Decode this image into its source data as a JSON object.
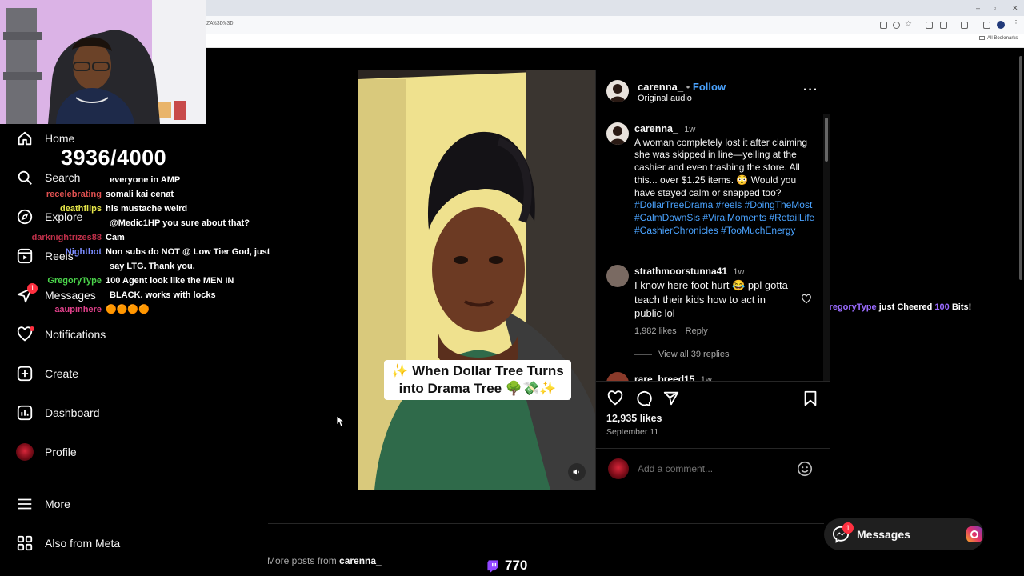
{
  "browser": {
    "url_fragment": "ZA%3D%3D",
    "bookmarks_label": "All Bookmarks",
    "window_controls": [
      "–",
      "▫",
      "✕"
    ]
  },
  "sidebar": {
    "items": [
      {
        "label": "Home",
        "icon": "home-icon"
      },
      {
        "label": "Search",
        "icon": "search-icon"
      },
      {
        "label": "Explore",
        "icon": "compass-icon"
      },
      {
        "label": "Reels",
        "icon": "reels-icon"
      },
      {
        "label": "Messages",
        "icon": "send-icon",
        "badge": "1"
      },
      {
        "label": "Notifications",
        "icon": "heart-icon"
      },
      {
        "label": "Create",
        "icon": "plus-square-icon"
      },
      {
        "label": "Dashboard",
        "icon": "chart-icon"
      },
      {
        "label": "Profile",
        "icon": "avatar-icon"
      },
      {
        "label": "More",
        "icon": "menu-icon"
      },
      {
        "label": "Also from Meta",
        "icon": "meta-icon"
      }
    ]
  },
  "overlay": {
    "counter": "3936/4000",
    "chat": [
      {
        "user": "",
        "user_color": "#ffffff",
        "message": "everyone in AMP"
      },
      {
        "user": "recelebrating",
        "user_color": "#e05050",
        "message": "somali kai cenat"
      },
      {
        "user": "deathflips",
        "user_color": "#e8e84a",
        "message": "his mustache weird"
      },
      {
        "user": "",
        "user_color": "#ffffff",
        "message": "@Medic1HP you sure about that?"
      },
      {
        "user": "darknightrizes88",
        "user_color": "#c0304a",
        "message": "Cam"
      },
      {
        "user": "Nightbot",
        "user_color": "#7b8cff",
        "message": "Non subs do NOT @ Low Tier God, just"
      },
      {
        "user": "",
        "user_color": "#ffffff",
        "message": "say LTG. Thank you."
      },
      {
        "user": "GregoryType",
        "user_color": "#4bd54b",
        "message": "100 Agent look like the MEN IN"
      },
      {
        "user": "",
        "user_color": "#ffffff",
        "message": "BLACK. works with locks"
      },
      {
        "user": "aaupinhere",
        "user_color": "#e0408a",
        "message": "🟠🟠🟠🟠"
      }
    ],
    "cheer": {
      "user": "GregoryType",
      "text": " just Cheered ",
      "amount": "100",
      "suffix": " Bits!"
    },
    "viewer_count": "770"
  },
  "post": {
    "video_caption_line1": "✨ When Dollar Tree Turns",
    "video_caption_line2": "into Drama Tree 🌳💸✨",
    "author": "carenna_",
    "follow_sep": "•",
    "follow_label": "Follow",
    "audio_label": "Original audio",
    "caption": {
      "user": "carenna_",
      "time": "1w",
      "text": "A woman completely lost it after claiming she was skipped in line—yelling at the cashier and even trashing the store. All this... over $1.25 items. 😳 Would you have stayed calm or snapped too?",
      "hashtags": "#DollarTreeDrama #reels #DoingTheMost #CalmDownSis #ViralMoments #RetailLife #CashierChronicles #TooMuchEnergy"
    },
    "comments": [
      {
        "user": "strathmoorstunna41",
        "time": "1w",
        "text": "I know here foot hurt 😂 ppl gotta teach their kids how to act in public lol",
        "likes": "1,982 likes",
        "reply": "Reply",
        "view_replies": "View all 39 replies"
      },
      {
        "user": "rare_breed15",
        "time": "1w"
      }
    ],
    "likes": "12,935 likes",
    "date": "September 11",
    "comment_placeholder": "Add a comment..."
  },
  "footer": {
    "more_posts_prefix": "More posts from ",
    "more_posts_user": "carenna_"
  },
  "messages_pill": {
    "label": "Messages",
    "badge": "1"
  },
  "colors": {
    "accent": "#0095f6",
    "link": "#4aa3ff",
    "background": "#000000",
    "twitch": "#9146ff"
  }
}
